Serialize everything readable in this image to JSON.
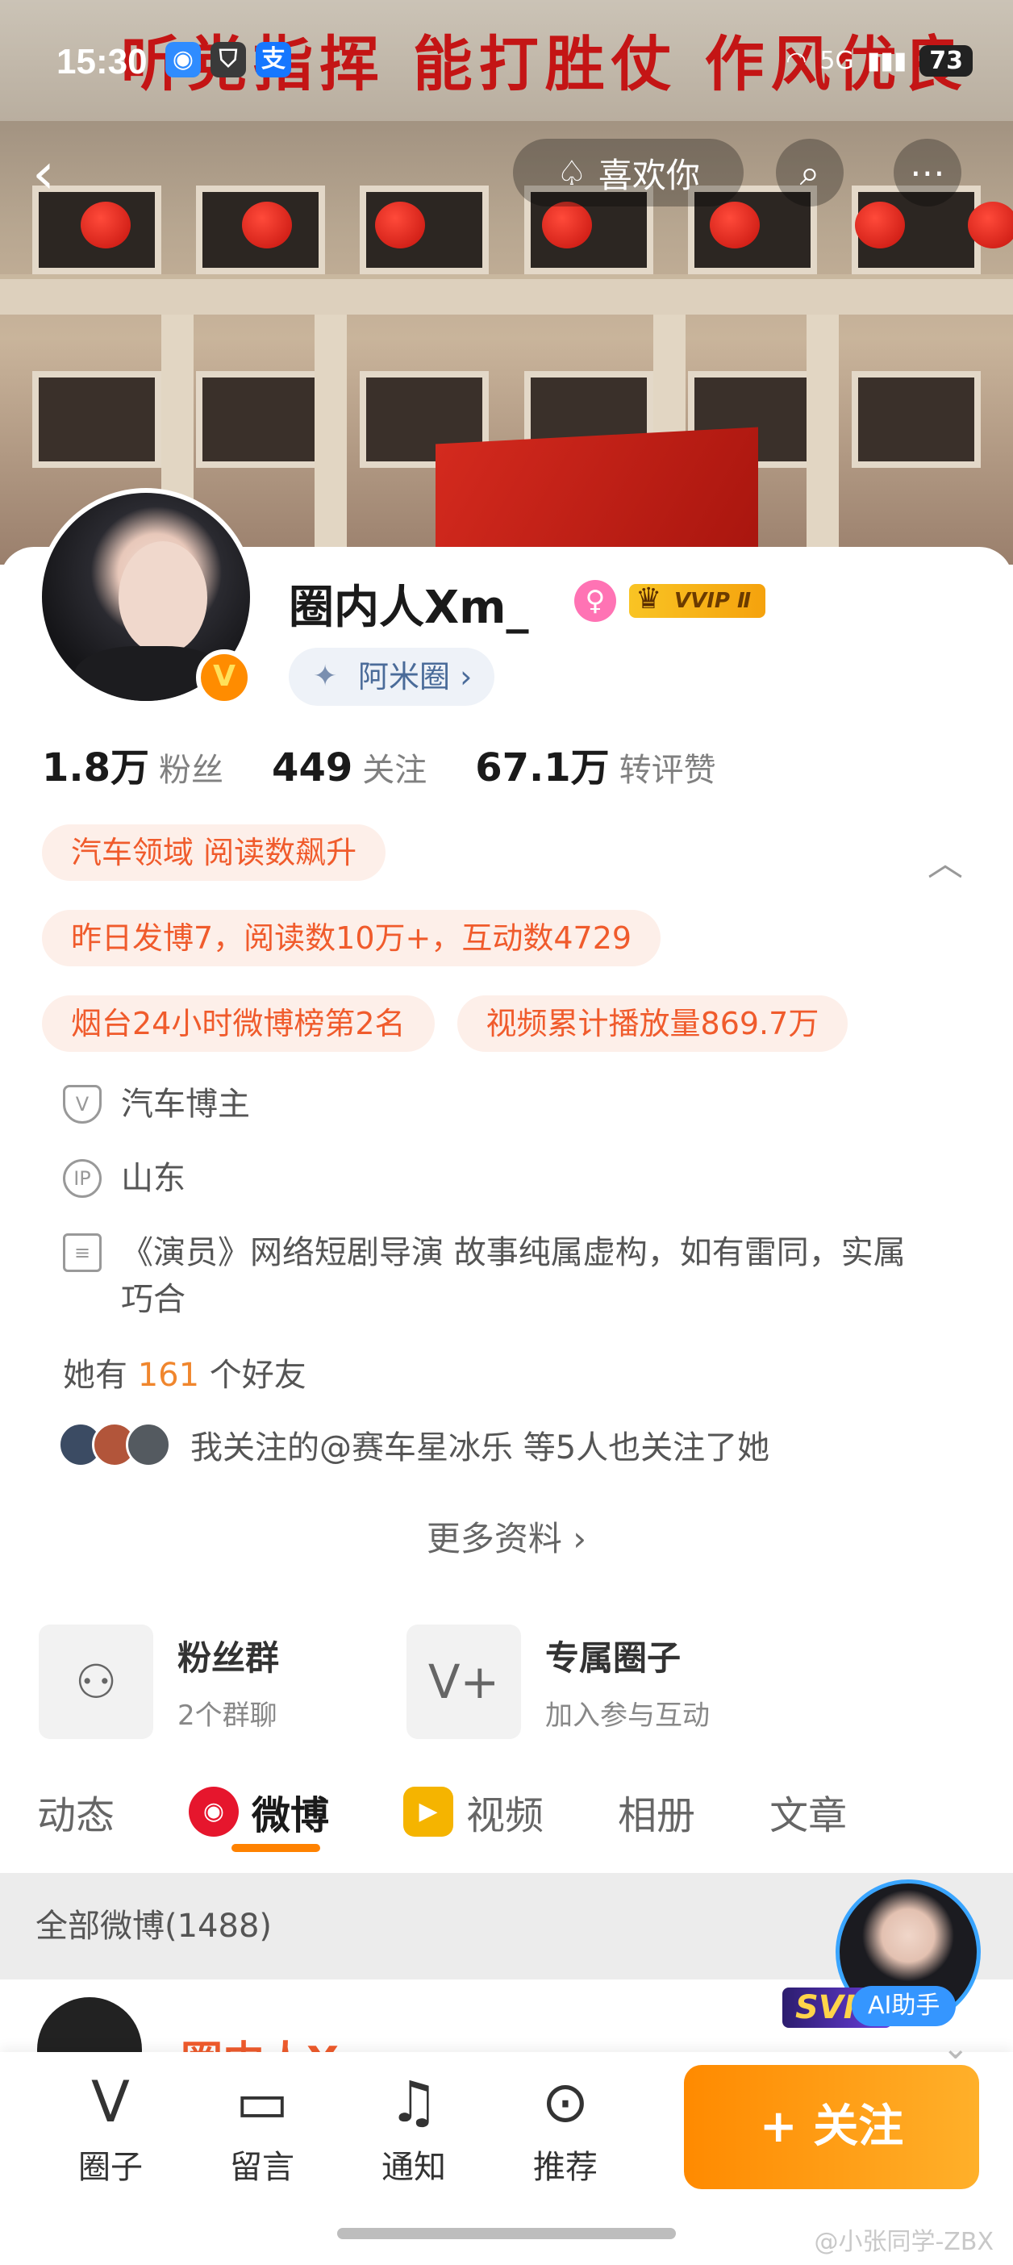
{
  "status_bar": {
    "time": "15:30",
    "network": "5G",
    "battery": "73"
  },
  "cover": {
    "banner": "听党指挥 能打胜仗 作风优良"
  },
  "header": {
    "like_label": "喜欢你"
  },
  "profile": {
    "name": "圈内人Xm_",
    "vip_badge": "VVIP Ⅱ",
    "circle_tag": "阿米圈 ›",
    "verified_badge": "V"
  },
  "stats": [
    {
      "num": "1.8万",
      "label": "粉丝"
    },
    {
      "num": "449",
      "label": "关注"
    },
    {
      "num": "67.1万",
      "label": "转评赞"
    }
  ],
  "highlights": {
    "row1": [
      "汽车领域 阅读数飙升"
    ],
    "row2": [
      "昨日发博7，阅读数10万+，互动数4729"
    ],
    "row3": [
      "烟台24小时微博榜第2名",
      "视频累计播放量869.7万"
    ]
  },
  "info": {
    "category": "汽车博主",
    "ip": "山东",
    "bio": "《演员》网络短剧导演 故事纯属虚构，如有雷同，实属巧合",
    "friends_prefix": "她有",
    "friends_count": "161",
    "friends_suffix": "个好友",
    "mutual": "我关注的@赛车星冰乐 等5人也关注了她",
    "more": "更多资料 ›"
  },
  "features": [
    {
      "title": "粉丝群",
      "sub": "2个群聊"
    },
    {
      "title": "专属圈子",
      "sub": "加入参与互动"
    }
  ],
  "tabs": [
    "动态",
    "微博",
    "视频",
    "相册",
    "文章"
  ],
  "filter": {
    "label": "全部微博(1488)"
  },
  "post_peek": {
    "name": "圈内人Xm_"
  },
  "ai": {
    "svip": "SVIP",
    "label": "AI助手"
  },
  "bottom": {
    "items": [
      "圈子",
      "留言",
      "通知",
      "推荐"
    ],
    "follow": "+ 关注"
  },
  "watermark": "@小张同学-ZBX",
  "colors": {
    "accent": "#ff8200",
    "tag_bg": "#fdefe9",
    "tag_text": "#f05b2c"
  }
}
